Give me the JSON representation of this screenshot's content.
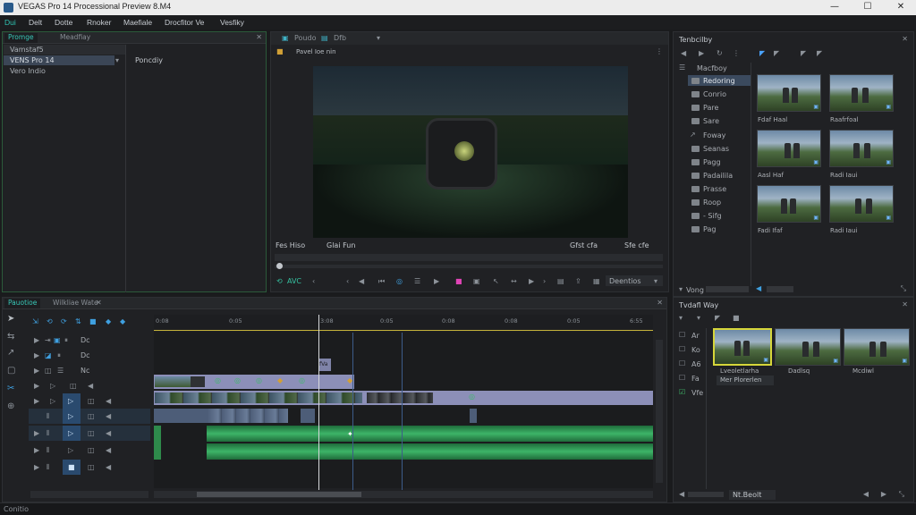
{
  "window": {
    "title": "VEGAS Pro 14 Processional Preview 8.M4",
    "controls": [
      "minimize",
      "maximize",
      "close"
    ]
  },
  "menu": [
    "Dui",
    "Delt",
    "Dotte",
    "Rnoker",
    "Maefiale",
    "Drocfitor Ve",
    "Vesfiky"
  ],
  "project_panel": {
    "tabs": [
      "Promge",
      "Meadfiay"
    ],
    "items": [
      "Vamstaf5",
      "VENS Pro 14",
      "Vero Indio"
    ],
    "detail_label": "Poncdiy"
  },
  "preview": {
    "toolbar_labels": [
      "Poudo",
      "Dfb"
    ],
    "sub_label": "Pavel Ioe nin",
    "time_left": "Fes Hiso",
    "time_mid": "Glai Fun",
    "time_right_1": "Gfst cfa",
    "time_right_2": "Sfe cfe",
    "footer_left": "AVC",
    "footer_right": "Deentios"
  },
  "media_browser": {
    "title": "Tenbcilby",
    "folders": [
      "Macfboy",
      "Redoring",
      "Conrio",
      "Pare",
      "Sare",
      "Foway",
      "Seanas",
      "Pagg",
      "Padailila",
      "Prasse",
      "Roop",
      "- Sifg",
      "Pag"
    ],
    "thumb_labels": [
      "Fdaf Haal",
      "Raafrfoal",
      "Aasl Haf",
      "Radi Iaui",
      "Fadi Ifaf",
      "Radi Iaui"
    ],
    "footer": "Vong"
  },
  "bin_panel": {
    "title": "Tvdafl Way",
    "list": [
      "Ar",
      "Ko",
      "A6",
      "Fa",
      "Vfe"
    ],
    "thumb_labels": [
      "Lveoletlarha",
      "Dadlsq",
      "Mcdiwl"
    ],
    "tooltip": "Mer Plorerlen",
    "footer": "Nt.Beolt"
  },
  "timeline": {
    "tabs": [
      "Pauotioe",
      "Wilkliae Wate"
    ],
    "ruler": [
      "0:08",
      "0:05",
      "3:08",
      "0:05",
      "0:08",
      "0:08",
      "0:05",
      "6:55"
    ],
    "marker": "fVa",
    "tracks": [
      {
        "label": "Dc",
        "kind": "video"
      },
      {
        "label": "Dc",
        "kind": "video"
      },
      {
        "label": "Nc",
        "kind": "video"
      },
      {
        "label": "",
        "kind": "video"
      },
      {
        "label": "",
        "kind": "video"
      },
      {
        "label": "",
        "kind": "audio"
      },
      {
        "label": "",
        "kind": "audio"
      },
      {
        "label": "",
        "kind": "audio"
      }
    ]
  },
  "statusbar": {
    "left": "Conitio"
  },
  "colors": {
    "accent": "#2fc3b2",
    "clip": "#8c8fb8",
    "audio": "#2e8a4b",
    "playhead": "#d7d9dc"
  }
}
